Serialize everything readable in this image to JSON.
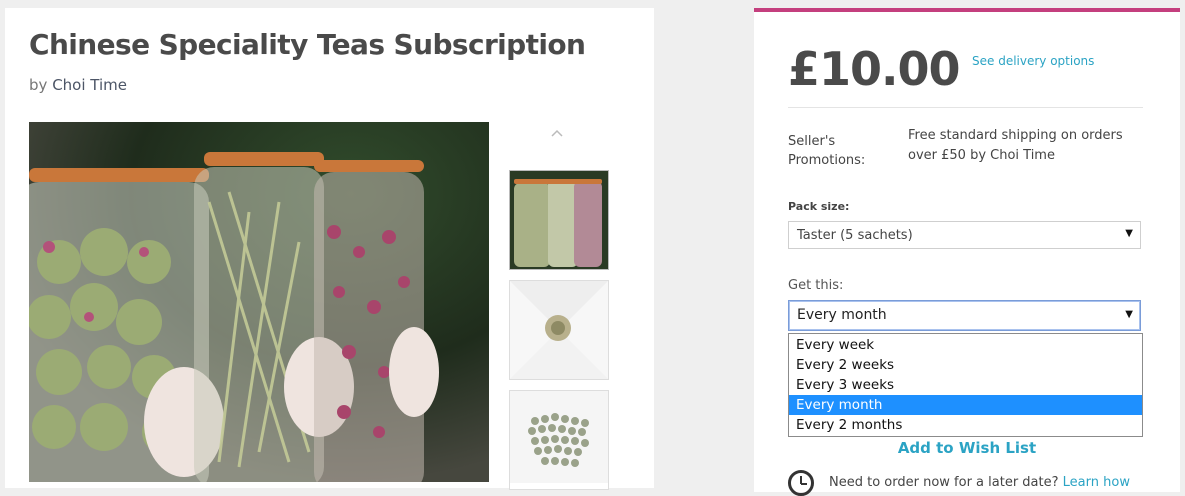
{
  "product": {
    "title": "Chinese Speciality Teas Subscription",
    "by_prefix": "by",
    "seller": "Choi Time"
  },
  "gallery": {
    "main_image_alt": "jars-of-tea-icon",
    "thumbnails": [
      "thumbnail-jars",
      "thumbnail-tea-ball",
      "thumbnail-loose-tea"
    ],
    "scroll_up_icon": "chevron-up-icon"
  },
  "purchase": {
    "price": "£10.00",
    "delivery_link": "See delivery options",
    "promotions_label": "Seller's Promotions:",
    "promotions_text": "Free standard shipping on orders over £50 by Choi Time",
    "pack_size_label": "Pack size:",
    "pack_size_value": "Taster (5 sachets)",
    "frequency_label": "Get this:",
    "frequency_value": "Every month",
    "frequency_options": [
      "Every week",
      "Every 2 weeks",
      "Every 3 weeks",
      "Every month",
      "Every 2 months"
    ],
    "wishlist_label": "Add to Wish List",
    "later_text": "Need to order now for a later date?",
    "later_link": "Learn how"
  },
  "colors": {
    "accent_top_border": "#c43f7e",
    "link": "#2ba3c4",
    "selected_option": "#1e90ff"
  }
}
